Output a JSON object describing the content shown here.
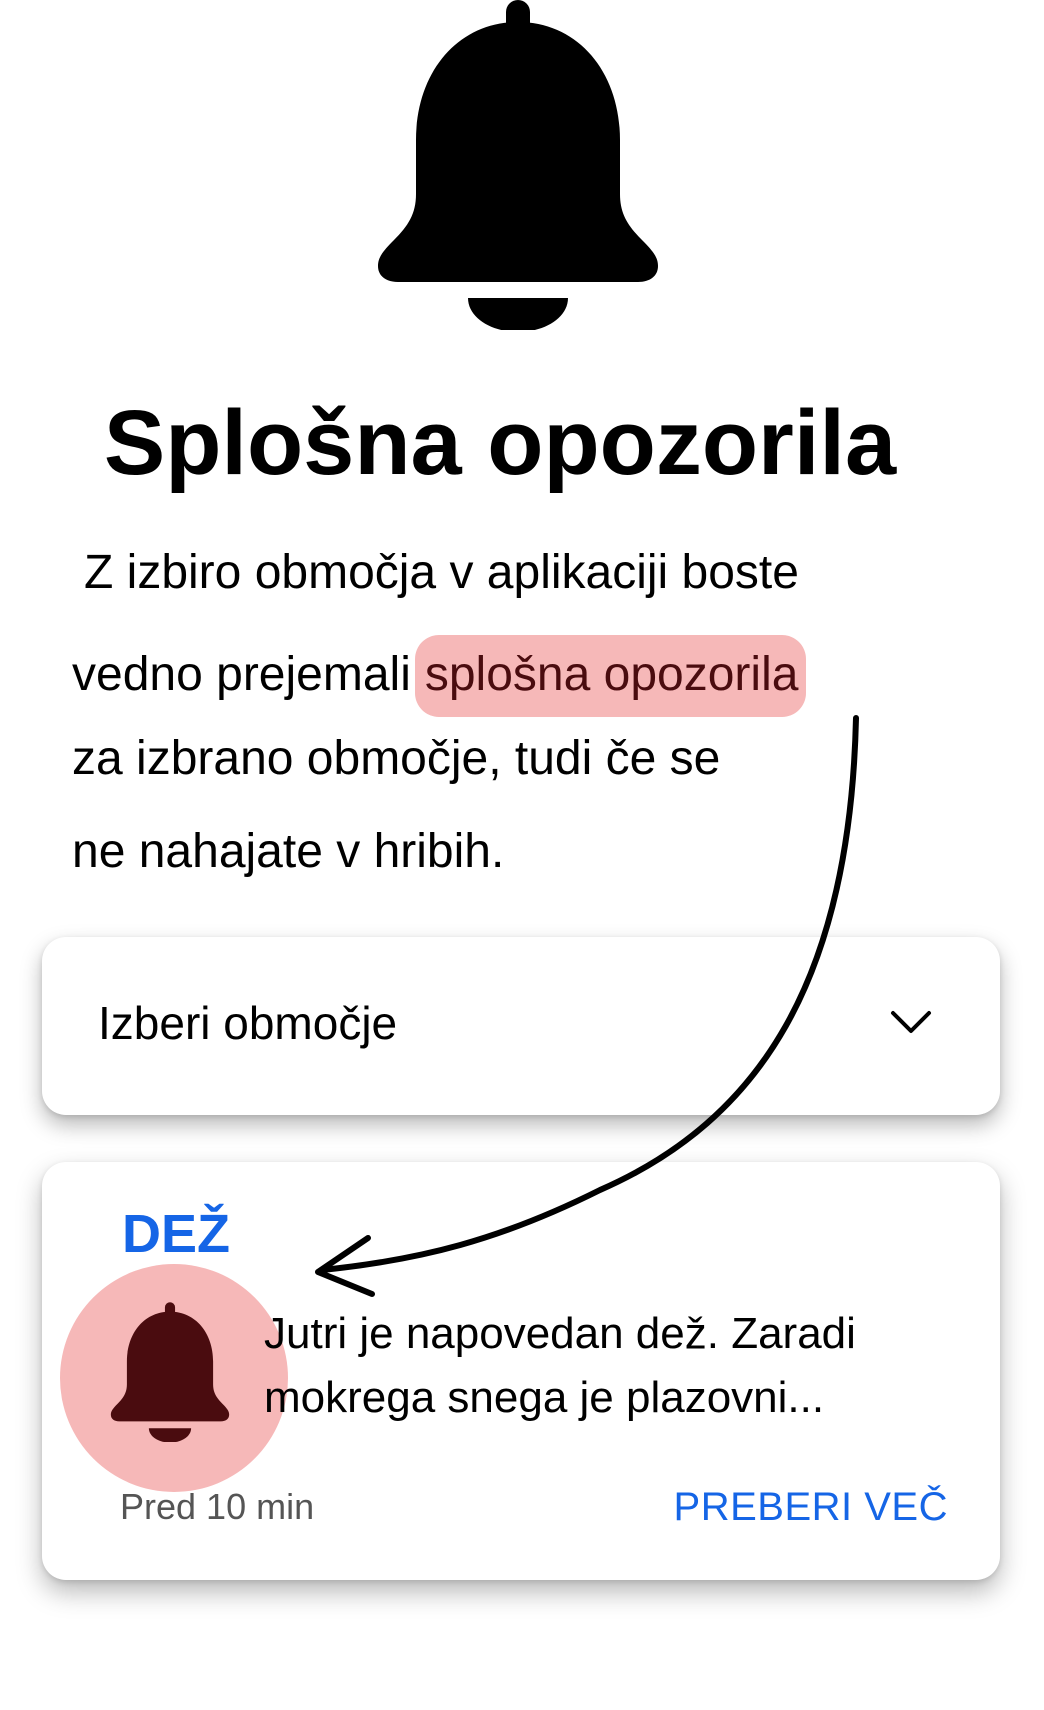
{
  "hero": {
    "icon": "bell-icon",
    "title": "Splošna opozorila"
  },
  "description": {
    "line1": "Z izbiro območja v aplikaciji boste",
    "line2_prefix": "vedno prejemali",
    "line2_highlight": "splošna opozorila",
    "line3": "za izbrano območje, tudi če se",
    "line4": "ne nahajate v hribih."
  },
  "area_select": {
    "label": "Izberi območje",
    "icon": "chevron-down-icon"
  },
  "notification": {
    "title": "DEŽ",
    "icon": "bell-icon",
    "body_line1": "Jutri je napovedan dež. Zaradi",
    "body_line2": "mokrega snega je plazovni...",
    "time": "Pred 10 min",
    "read_more": "PREBERI VEČ"
  },
  "colors": {
    "accent_blue": "#1565e6",
    "highlight_bg": "#f6b8b8",
    "highlight_text": "#4a0c0f",
    "icon_dark": "#4a0c0f"
  }
}
